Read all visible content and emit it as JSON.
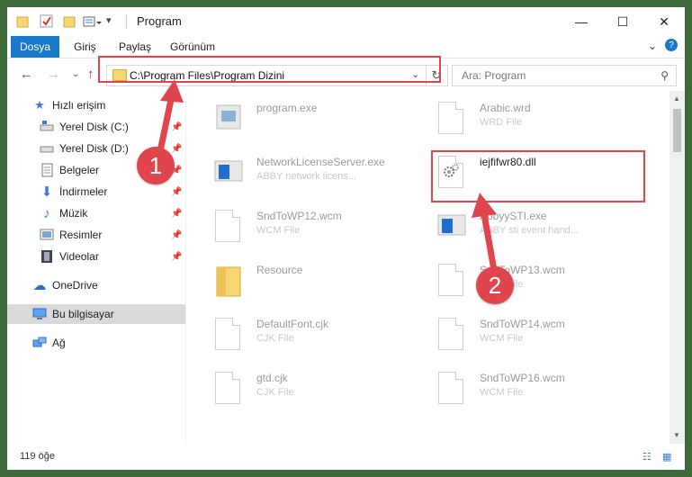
{
  "window": {
    "title": "Program"
  },
  "ribbon": {
    "file_tab": "Dosya",
    "tabs": [
      "Giriş",
      "Paylaş",
      "Görünüm"
    ]
  },
  "address": {
    "path": "C:\\Program Files\\Program Dizini"
  },
  "search": {
    "placeholder": "Ara: Program"
  },
  "sidebar": {
    "quick_access": "Hızlı erişim",
    "items": [
      {
        "label": "Yerel Disk (C:)",
        "icon": "drive-icon"
      },
      {
        "label": "Yerel Disk (D:)",
        "icon": "drive-icon"
      },
      {
        "label": "Belgeler",
        "icon": "documents-icon"
      },
      {
        "label": "İndirmeler",
        "icon": "downloads-icon"
      },
      {
        "label": "Müzik",
        "icon": "music-icon"
      },
      {
        "label": "Resimler",
        "icon": "pictures-icon"
      },
      {
        "label": "Videolar",
        "icon": "videos-icon"
      }
    ],
    "onedrive": "OneDrive",
    "this_pc": "Bu bilgisayar",
    "network": "Ağ"
  },
  "files": [
    {
      "name": "program.exe",
      "type": ""
    },
    {
      "name": "Arabic.wrd",
      "type": "WRD File"
    },
    {
      "name": "NetworkLicenseServer.exe",
      "type": "ABBY network licens..."
    },
    {
      "name": "iejfifwr80.dll",
      "type": ""
    },
    {
      "name": "SndToWP12.wcm",
      "type": "WCM File"
    },
    {
      "name": "AbbyySTI.exe",
      "type": "ABBY sti event hand..."
    },
    {
      "name": "Resource",
      "type": ""
    },
    {
      "name": "SndToWP13.wcm",
      "type": "WCM File"
    },
    {
      "name": "DefaultFont.cjk",
      "type": "CJK File"
    },
    {
      "name": "SndToWP14.wcm",
      "type": "WCM File"
    },
    {
      "name": "gtd.cjk",
      "type": "CJK File"
    },
    {
      "name": "SndToWP16.wcm",
      "type": "WCM File"
    }
  ],
  "status": {
    "count": "119 öğe"
  },
  "markers": {
    "one": "1",
    "two": "2"
  },
  "colors": {
    "accent": "#1979ca",
    "highlight": "#e0454d"
  }
}
